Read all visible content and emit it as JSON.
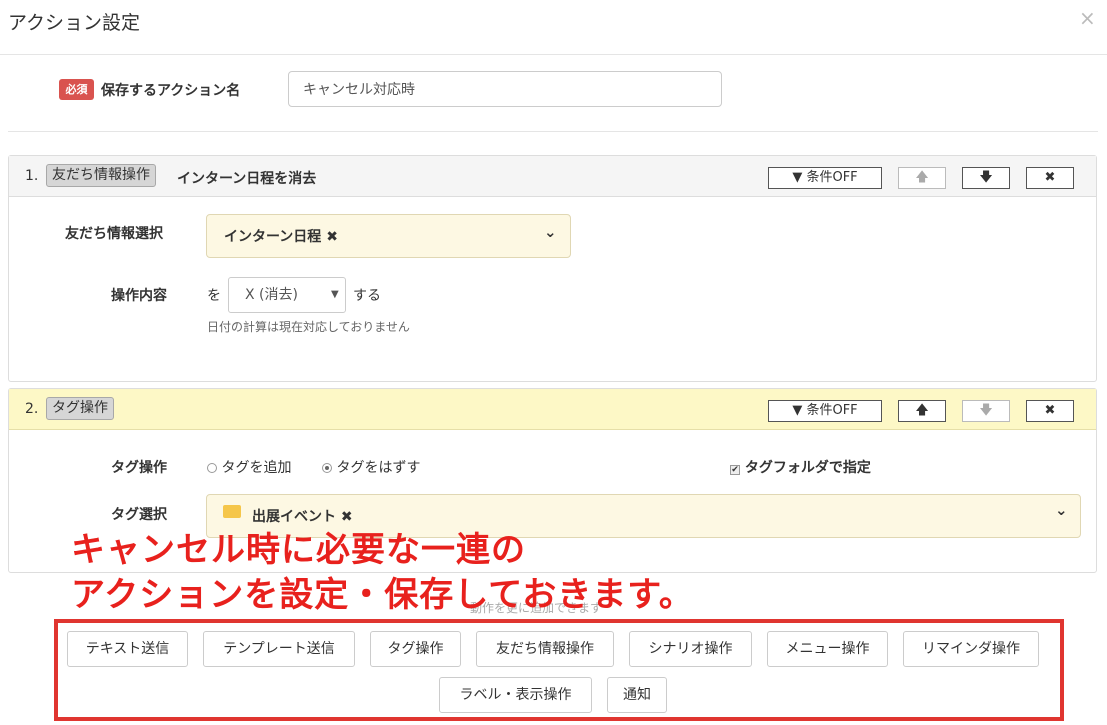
{
  "dialog": {
    "title": "アクション設定",
    "close_icon": "×"
  },
  "action_name": {
    "required_badge": "必須",
    "label": "保存するアクション名",
    "value": "キャンセル対応時"
  },
  "header_buttons": {
    "condition_label": "条件OFF"
  },
  "step1": {
    "number": "1.",
    "type_tag": "友だち情報操作",
    "title": "インターン日程を消去",
    "field_label": "友だち情報選択",
    "field_value": "インターン日程",
    "remove_mark": "✖",
    "operation_label": "操作内容",
    "prefix": "を",
    "operation_value": "X (消去)",
    "suffix": "する",
    "note": "日付の計算は現在対応しておりません"
  },
  "step2": {
    "number": "2.",
    "type_tag": "タグ操作",
    "op_label": "タグ操作",
    "radio_add": "タグを追加",
    "radio_remove": "タグをはずす",
    "checkbox_label": "タグフォルダで指定",
    "select_label": "タグ選択",
    "select_value": "出展イベント",
    "remove_mark": "✖"
  },
  "overlay": {
    "line1": "キャンセル時に必要な一連の",
    "line2": "アクションを設定・保存しておきます。"
  },
  "add_more_hint": "動作を更に追加できます",
  "add_buttons": [
    "テキスト送信",
    "テンプレート送信",
    "タグ操作",
    "友だち情報操作",
    "シナリオ操作",
    "メニュー操作",
    "リマインダ操作",
    "ラベル・表示操作",
    "通知"
  ],
  "colors": {
    "required": "#d9534f",
    "highlight_header": "#fdf8c6",
    "overlay_text": "#e8211d",
    "frame": "#e03530"
  }
}
